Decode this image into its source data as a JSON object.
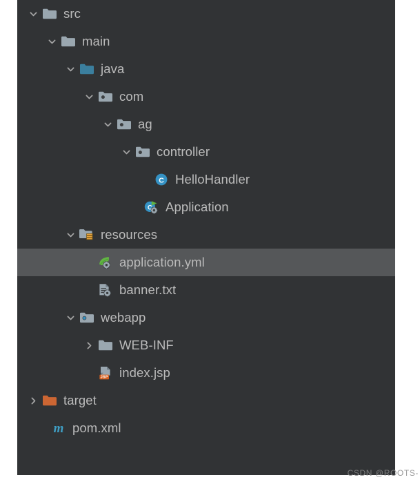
{
  "panel": {
    "name": "project-tree",
    "background": "#313335",
    "selected_background": "#555759",
    "text_color": "#bbbbbb"
  },
  "colors": {
    "folder_gray": "#9aa7b0",
    "folder_teal": "#3b7f9e",
    "folder_orange": "#cc6633",
    "accent_green": "#62b543",
    "class_teal": "#3592c4",
    "maven_teal": "#3f9ec4",
    "jsp_orange": "#d6601f",
    "panel_bg": "#313335",
    "selected_bg": "#555759",
    "text": "#bbbbbb"
  },
  "tree": {
    "nodes": [
      {
        "label": "src",
        "indent": 0,
        "state": "expanded",
        "icon": "folder-icon",
        "selected": false
      },
      {
        "label": "main",
        "indent": 1,
        "state": "expanded",
        "icon": "folder-icon",
        "selected": false
      },
      {
        "label": "java",
        "indent": 2,
        "state": "expanded",
        "icon": "source-folder-icon",
        "selected": false
      },
      {
        "label": "com",
        "indent": 3,
        "state": "expanded",
        "icon": "package-folder-icon",
        "selected": false
      },
      {
        "label": "ag",
        "indent": 4,
        "state": "expanded",
        "icon": "package-folder-icon",
        "selected": false
      },
      {
        "label": "controller",
        "indent": 5,
        "state": "expanded",
        "icon": "package-folder-icon",
        "selected": false
      },
      {
        "label": "HelloHandler",
        "indent": 6,
        "state": "leaf",
        "icon": "java-class-icon",
        "selected": false
      },
      {
        "label": "Application",
        "indent": 5,
        "state": "leaf-noindent",
        "icon": "spring-boot-class-icon",
        "selected": false
      },
      {
        "label": "resources",
        "indent": 2,
        "state": "expanded",
        "icon": "resources-folder-icon",
        "selected": false
      },
      {
        "label": "application.yml",
        "indent": 3,
        "state": "leaf",
        "icon": "spring-yaml-icon",
        "selected": true
      },
      {
        "label": "banner.txt",
        "indent": 3,
        "state": "leaf",
        "icon": "text-config-file-icon",
        "selected": false
      },
      {
        "label": "webapp",
        "indent": 2,
        "state": "expanded",
        "icon": "webapp-folder-icon",
        "selected": false
      },
      {
        "label": "WEB-INF",
        "indent": 3,
        "state": "collapsed",
        "icon": "folder-icon",
        "selected": false
      },
      {
        "label": "index.jsp",
        "indent": 3,
        "state": "leaf",
        "icon": "jsp-file-icon",
        "selected": false
      },
      {
        "label": "target",
        "indent": 0,
        "state": "collapsed",
        "icon": "excluded-folder-icon",
        "selected": false
      },
      {
        "label": "pom.xml",
        "indent": 0,
        "state": "leaf-noindent",
        "icon": "maven-file-icon",
        "selected": false
      }
    ]
  },
  "watermark": {
    "text": "CSDN @ROOTS-"
  }
}
